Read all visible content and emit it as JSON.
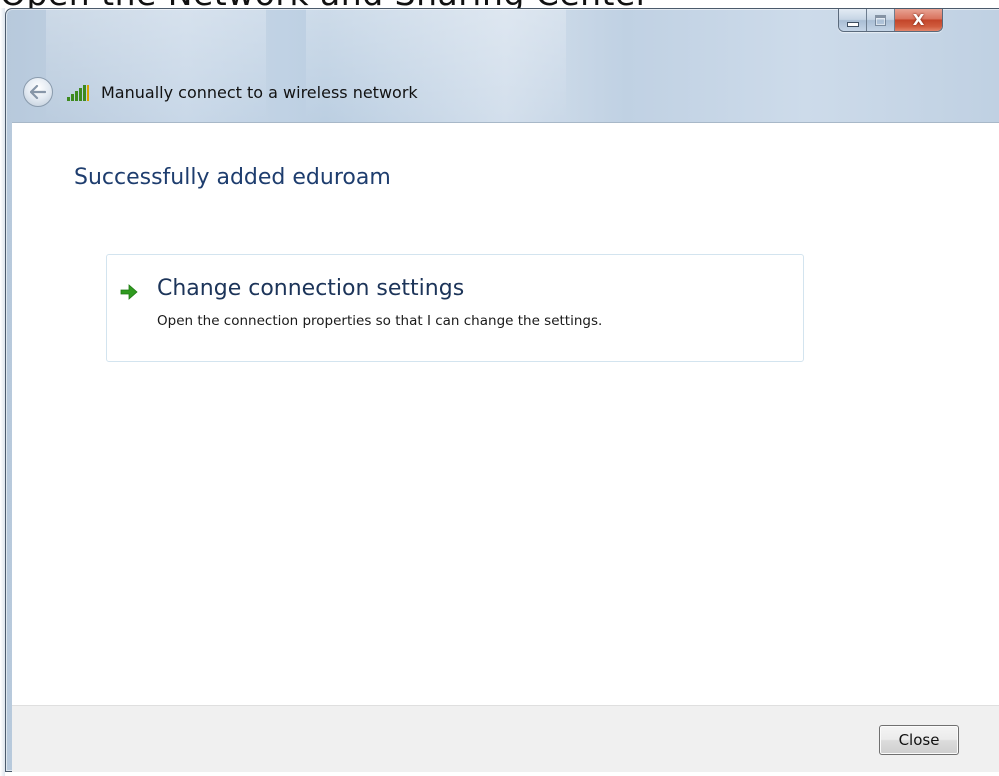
{
  "background_page": {
    "cropped_text": "Open the Network and Sharing Center"
  },
  "window": {
    "title": "Manually connect to a wireless network",
    "controls": {
      "minimize_icon": "minimize-icon",
      "maximize_icon": "maximize-icon",
      "close_glyph": "X"
    }
  },
  "nav": {
    "back_icon": "back-arrow-icon",
    "network_icon": "wireless-signal-icon"
  },
  "content": {
    "heading": "Successfully added eduroam",
    "command_link": {
      "icon": "green-arrow-icon",
      "title": "Change connection settings",
      "description": "Open the connection properties so that I can change the settings."
    }
  },
  "footer": {
    "close_label": "Close"
  },
  "colors": {
    "heading": "#1e3d6e",
    "link_title": "#1c3459",
    "arrow": "#2f9a1f",
    "close_button_red": "#c3452a",
    "footer_bg": "#f0f0f0"
  }
}
